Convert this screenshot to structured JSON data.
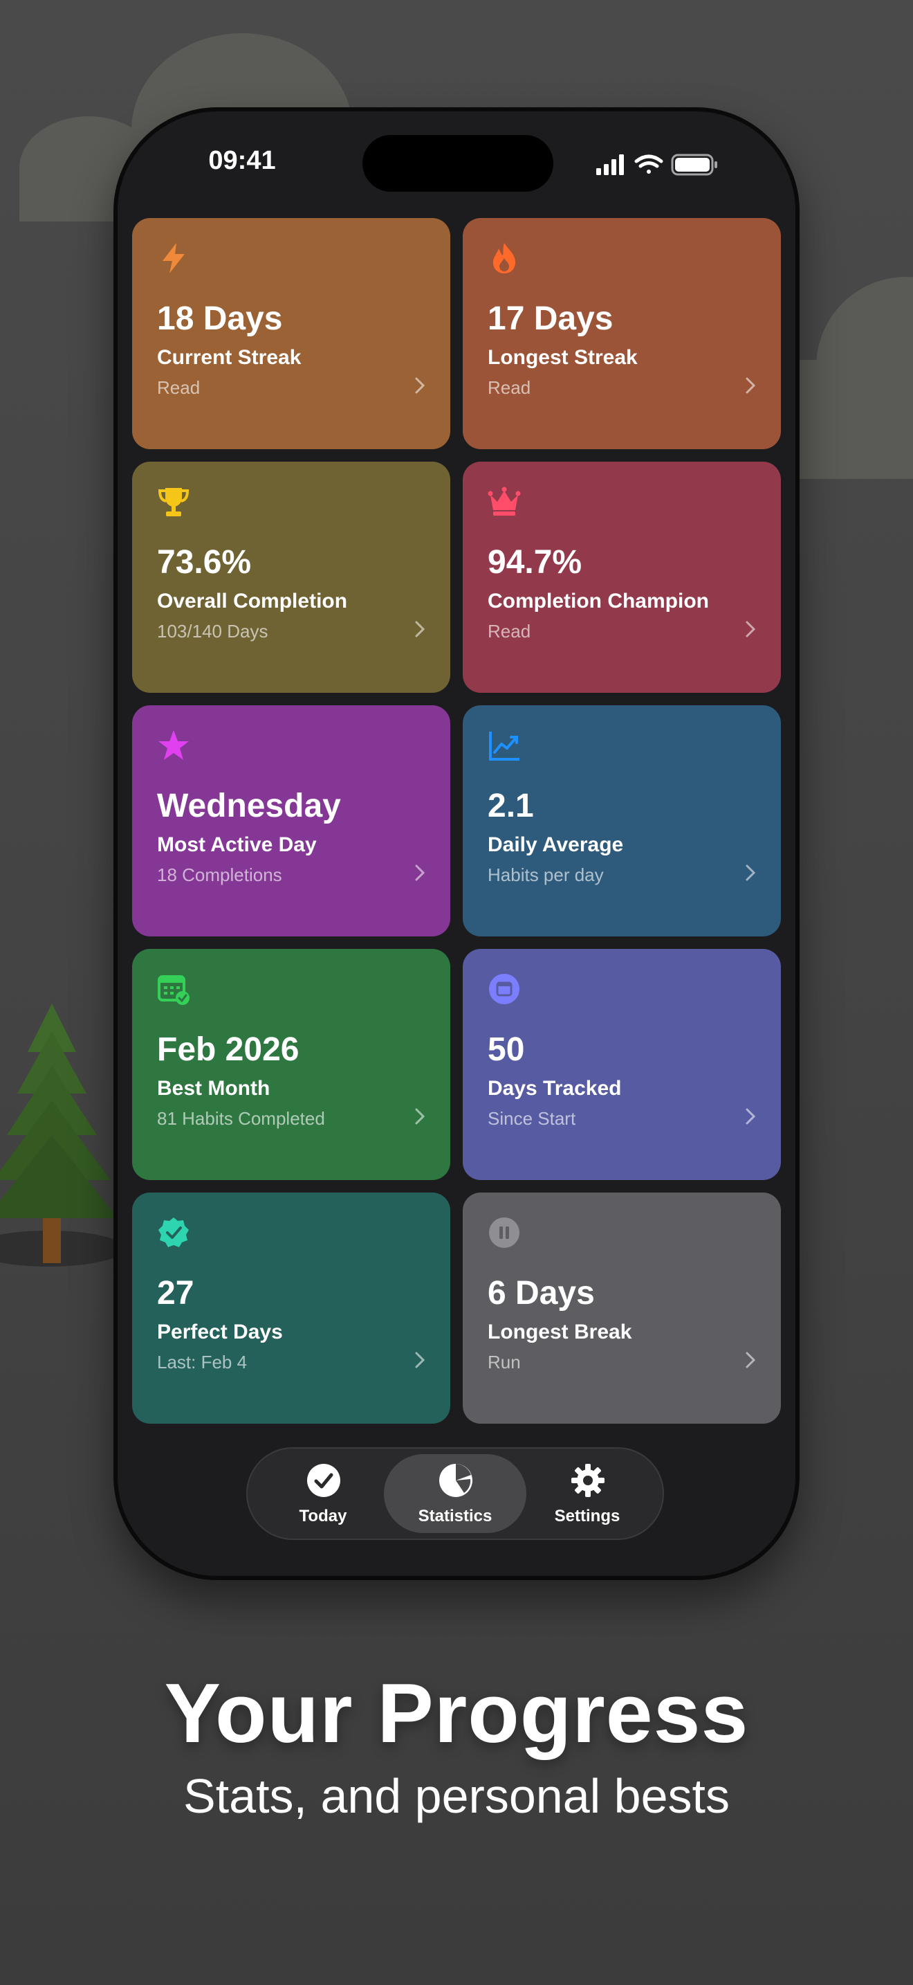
{
  "status_bar": {
    "time": "09:41"
  },
  "cards": [
    {
      "value": "18 Days",
      "label": "Current Streak",
      "sub": "Read",
      "icon": "bolt-icon",
      "color": "#9a6235",
      "accent": "#f0893a"
    },
    {
      "value": "17 Days",
      "label": "Longest Streak",
      "sub": "Read",
      "icon": "flame-icon",
      "color": "#9b5438",
      "accent": "#ff6a2b"
    },
    {
      "value": "73.6%",
      "label": "Overall Completion",
      "sub": "103/140 Days",
      "icon": "trophy-icon",
      "color": "#6f6333",
      "accent": "#f5c518"
    },
    {
      "value": "94.7%",
      "label": "Completion Champion",
      "sub": "Read",
      "icon": "crown-icon",
      "color": "#923a4b",
      "accent": "#ff4d6a"
    },
    {
      "value": "Wednesday",
      "label": "Most Active Day",
      "sub": "18 Completions",
      "icon": "star-icon",
      "color": "#843794",
      "accent": "#e040f0"
    },
    {
      "value": "2.1",
      "label": "Daily Average",
      "sub": "Habits per day",
      "icon": "chart-line-icon",
      "color": "#2e5a7b",
      "accent": "#1e90ff"
    },
    {
      "value": "Feb 2026",
      "label": "Best Month",
      "sub": "81 Habits Completed",
      "icon": "calendar-check-icon",
      "color": "#2e7741",
      "accent": "#34d058"
    },
    {
      "value": "50",
      "label": "Days Tracked",
      "sub": "Since Start",
      "icon": "calendar-icon",
      "color": "#575ca2",
      "accent": "#7b7fff"
    },
    {
      "value": "27",
      "label": "Perfect Days",
      "sub": "Last: Feb 4",
      "icon": "seal-check-icon",
      "color": "#24615a",
      "accent": "#2ed3b0"
    },
    {
      "value": "6 Days",
      "label": "Longest Break",
      "sub": "Run",
      "icon": "pause-icon",
      "color": "#5e5e62",
      "accent": "#8e8e93"
    }
  ],
  "tabs": [
    {
      "label": "Today",
      "icon": "checkmark-circle-icon"
    },
    {
      "label": "Statistics",
      "icon": "pie-chart-icon",
      "active": true
    },
    {
      "label": "Settings",
      "icon": "gear-icon"
    }
  ],
  "headline": "Your Progress",
  "subheadline": "Stats, and personal bests"
}
